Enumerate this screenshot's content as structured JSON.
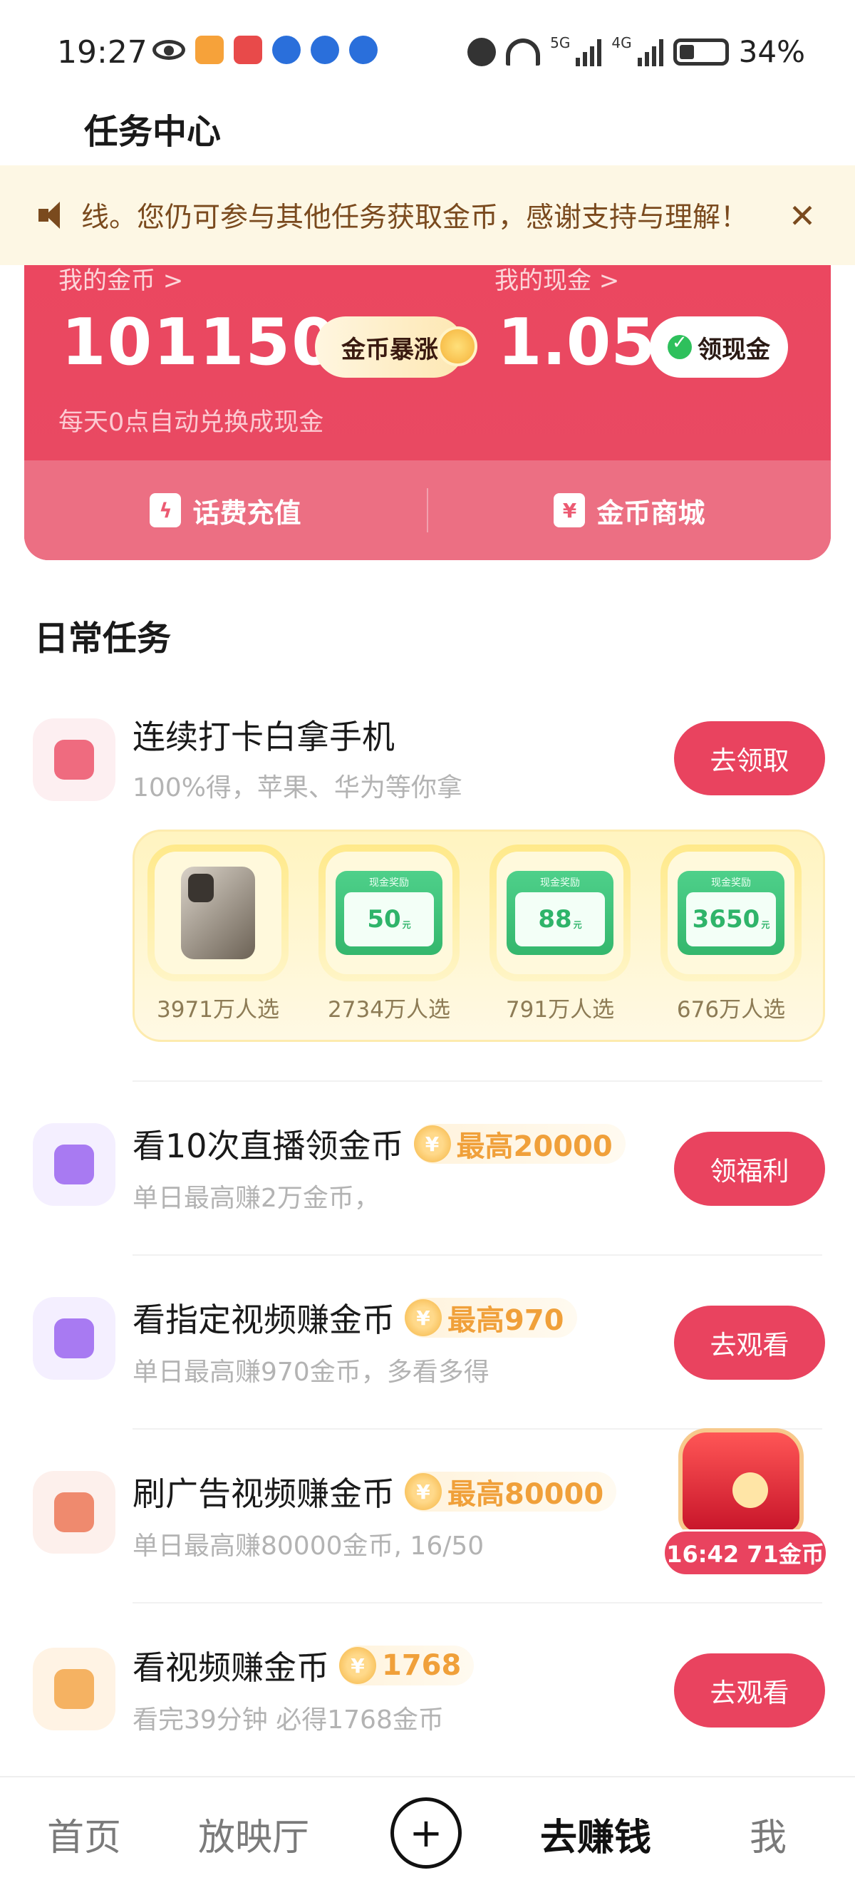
{
  "status_bar": {
    "time": "19:27",
    "network_5g": "5G",
    "network_4g": "4G",
    "battery": "34%"
  },
  "header": {
    "title": "任务中心"
  },
  "notice": {
    "text": "线。您仍可参与其他任务获取金币，感谢支持与理解！",
    "close": "✕"
  },
  "wallet": {
    "coin_label": "我的金币 >",
    "coin_value": "101150",
    "boom_label": "金币暴涨",
    "cash_label": "我的现金 >",
    "cash_value": "1.05",
    "claim_cash": "领现金",
    "sub": "每天0点自动兑换成现金",
    "recharge": "话费充值",
    "mall": "金币商城"
  },
  "daily": {
    "title": "日常任务",
    "tasks": [
      {
        "title": "连续打卡白拿手机",
        "sub": "100%得，苹果、华为等你拿",
        "button": "去领取",
        "prizes": [
          {
            "count": "3971万人选"
          },
          {
            "label": "现金奖励",
            "value": "50",
            "unit": "元",
            "count": "2734万人选"
          },
          {
            "label": "现金奖励",
            "value": "88",
            "unit": "元",
            "count": "791万人选"
          },
          {
            "label": "现金奖励",
            "value": "3650",
            "unit": "元",
            "count": "676万人选"
          }
        ]
      },
      {
        "title": "看10次直播领金币",
        "reward": "最高20000",
        "sub": "单日最高赚2万金币，",
        "button": "领福利"
      },
      {
        "title": "看指定视频赚金币",
        "reward": "最高970",
        "sub": "单日最高赚970金币，多看多得",
        "button": "去观看"
      },
      {
        "title": "刷广告视频赚金币",
        "reward": "最高80000",
        "sub": "单日最高赚80000金币, 16/50"
      },
      {
        "title": "看视频赚金币",
        "reward": "1768",
        "sub": "看完39分钟 必得1768金币",
        "button": "去观看"
      }
    ]
  },
  "treasure": {
    "badge": "16:42 71金币"
  },
  "bottom_nav": {
    "home": "首页",
    "cinema": "放映厅",
    "plus": "+",
    "earn": "去赚钱",
    "me": "我"
  },
  "colors": {
    "primary": "#e9435f",
    "reward": "#f0a03a",
    "notice_bg": "#fdf7e4"
  }
}
